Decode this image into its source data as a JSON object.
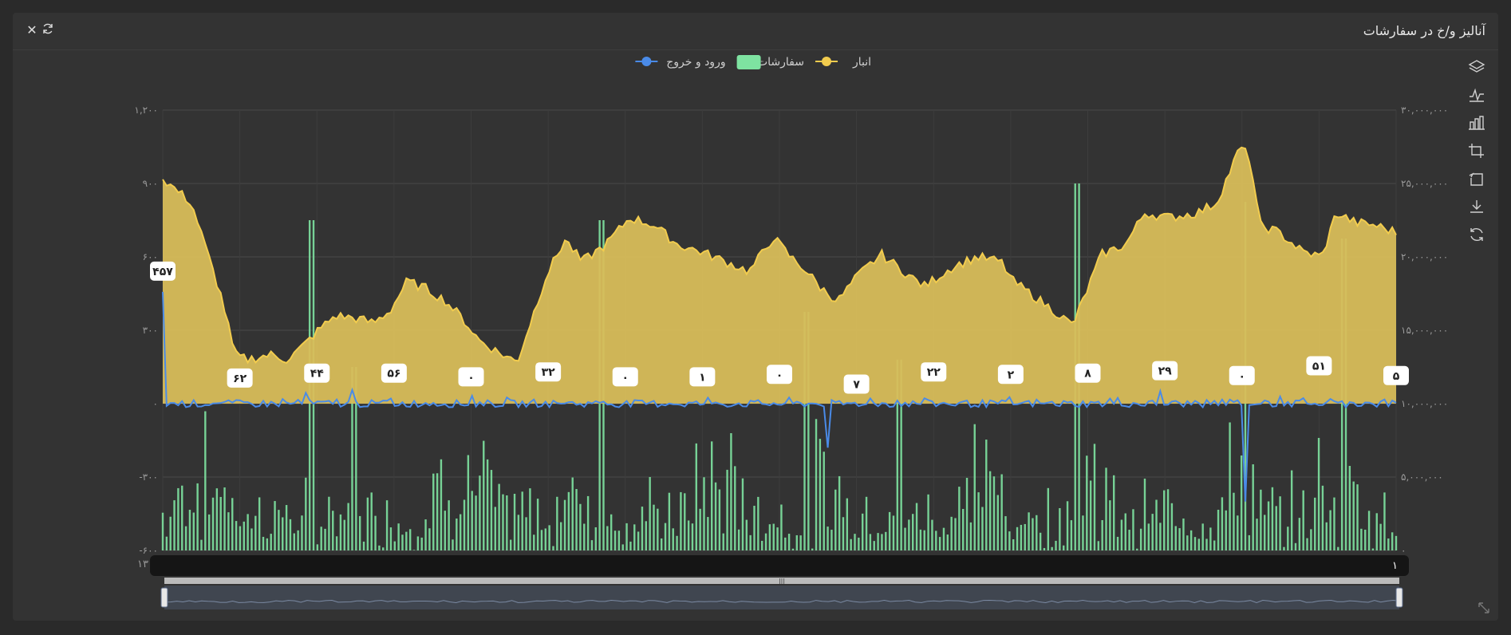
{
  "window": {
    "title": "آنالیز و/خ در سفارشات",
    "close_icon": "close-icon",
    "refresh_icon": "refresh-icon"
  },
  "toolbox": [
    "layers-icon",
    "line-chart-icon",
    "bar-chart-icon",
    "zoom-in-icon",
    "zoom-reset-icon",
    "download-icon",
    "restore-icon"
  ],
  "colors": {
    "stock": "#f2cc4e",
    "stock_fill": "#d8bd5a",
    "orders": "#7ee3a1",
    "io": "#4a8be8",
    "grid": "#4a4a4a",
    "label_text": "#9a9a9a"
  },
  "chart_data": {
    "type": "line",
    "legend": {
      "position": "top-center",
      "items": [
        {
          "name": "انبار",
          "color": "#f2cc4e",
          "kind": "line"
        },
        {
          "name": "سفارشات",
          "color": "#7ee3a1",
          "kind": "bar"
        },
        {
          "name": "ورود و خروج",
          "color": "#4a8be8",
          "kind": "line"
        }
      ]
    },
    "left_axis": {
      "min": -600,
      "max": 1200,
      "ticks": [
        "-۶۰۰",
        "-۳۰۰",
        "۰",
        "۳۰۰",
        "۶۰۰",
        "۹۰۰",
        "۱,۲۰۰"
      ]
    },
    "right_axis": {
      "min": 0,
      "max": 30000000,
      "ticks": [
        "۰",
        "۵,۰۰۰,۰۰۰",
        "۱۰,۰۰۰,۰۰۰",
        "۱۵,۰۰۰,۰۰۰",
        "۲۰,۰۰۰,۰۰۰",
        "۲۵,۰۰۰,۰۰۰",
        "۳۰,۰۰۰,۰۰۰"
      ]
    },
    "x_axis": {
      "start_label": "۱۳",
      "end_label": "۱"
    },
    "grid": true,
    "x_points": 320,
    "series": [
      {
        "name": "انبار",
        "axis": "left",
        "type": "area",
        "anchors": [
          [
            0,
            920
          ],
          [
            12,
            820
          ],
          [
            25,
            420
          ],
          [
            30,
            200
          ],
          [
            35,
            180
          ],
          [
            40,
            190
          ],
          [
            45,
            200
          ],
          [
            52,
            180
          ],
          [
            58,
            230
          ],
          [
            65,
            300
          ],
          [
            72,
            360
          ],
          [
            80,
            350
          ],
          [
            88,
            330
          ],
          [
            95,
            380
          ],
          [
            102,
            500
          ],
          [
            110,
            470
          ],
          [
            118,
            420
          ],
          [
            125,
            350
          ],
          [
            132,
            260
          ],
          [
            140,
            210
          ],
          [
            148,
            170
          ],
          [
            160,
            520
          ],
          [
            168,
            670
          ],
          [
            175,
            580
          ],
          [
            185,
            650
          ],
          [
            195,
            760
          ],
          [
            205,
            730
          ],
          [
            215,
            650
          ],
          [
            225,
            620
          ],
          [
            235,
            580
          ],
          [
            245,
            540
          ],
          [
            255,
            680
          ],
          [
            262,
            600
          ],
          [
            268,
            550
          ],
          [
            275,
            470
          ],
          [
            282,
            420
          ],
          [
            290,
            520
          ],
          [
            300,
            610
          ],
          [
            312,
            520
          ],
          [
            318,
            480
          ],
          [
            330,
            560
          ],
          [
            340,
            600
          ],
          [
            350,
            580
          ],
          [
            355,
            500
          ],
          [
            365,
            430
          ],
          [
            372,
            380
          ],
          [
            380,
            320
          ],
          [
            392,
            610
          ],
          [
            402,
            650
          ],
          [
            410,
            780
          ],
          [
            420,
            760
          ],
          [
            432,
            780
          ],
          [
            440,
            820
          ],
          [
            450,
            1050
          ],
          [
            454,
            1000
          ],
          [
            458,
            730
          ],
          [
            466,
            700
          ],
          [
            476,
            620
          ],
          [
            484,
            600
          ],
          [
            490,
            780
          ],
          [
            498,
            740
          ],
          [
            506,
            730
          ],
          [
            515,
            700
          ]
        ]
      },
      {
        "name": "ورود و خروج",
        "axis": "left",
        "type": "line"
      },
      {
        "name": "سفارشات",
        "axis": "right",
        "type": "bar"
      }
    ],
    "io_spikes": [
      [
        0,
        457
      ],
      [
        60,
        44
      ],
      [
        80,
        56
      ],
      [
        130,
        32
      ],
      [
        180,
        1
      ],
      [
        230,
        0
      ],
      [
        280,
        -180
      ],
      [
        320,
        22
      ],
      [
        360,
        2
      ],
      [
        420,
        51
      ],
      [
        470,
        29
      ],
      [
        505,
        5
      ],
      [
        455,
        -400
      ]
    ],
    "order_spikes": [
      [
        62,
        900
      ],
      [
        80,
        500
      ],
      [
        185,
        900
      ],
      [
        270,
        650
      ],
      [
        310,
        520
      ],
      [
        385,
        1000
      ],
      [
        455,
        950
      ],
      [
        496,
        850
      ]
    ],
    "point_labels": [
      {
        "text": "۴۵۷",
        "x": 0,
        "y": 457
      },
      {
        "text": "۶۲",
        "x": 32,
        "y": 20
      },
      {
        "text": "۴۴",
        "x": 64,
        "y": 40
      },
      {
        "text": "۵۶",
        "x": 96,
        "y": 40
      },
      {
        "text": "۰",
        "x": 128,
        "y": 25
      },
      {
        "text": "۳۲",
        "x": 160,
        "y": 45
      },
      {
        "text": "۰",
        "x": 192,
        "y": 25
      },
      {
        "text": "۱",
        "x": 224,
        "y": 25
      },
      {
        "text": "۰",
        "x": 256,
        "y": 35
      },
      {
        "text": "۷",
        "x": 288,
        "y": -5
      },
      {
        "text": "۲۲",
        "x": 320,
        "y": 45
      },
      {
        "text": "۲",
        "x": 352,
        "y": 35
      },
      {
        "text": "۸",
        "x": 384,
        "y": 40
      },
      {
        "text": "۲۹",
        "x": 416,
        "y": 50
      },
      {
        "text": "۰",
        "x": 448,
        "y": 30
      },
      {
        "text": "۵۱",
        "x": 480,
        "y": 70
      },
      {
        "text": "۵",
        "x": 512,
        "y": 30
      }
    ]
  }
}
